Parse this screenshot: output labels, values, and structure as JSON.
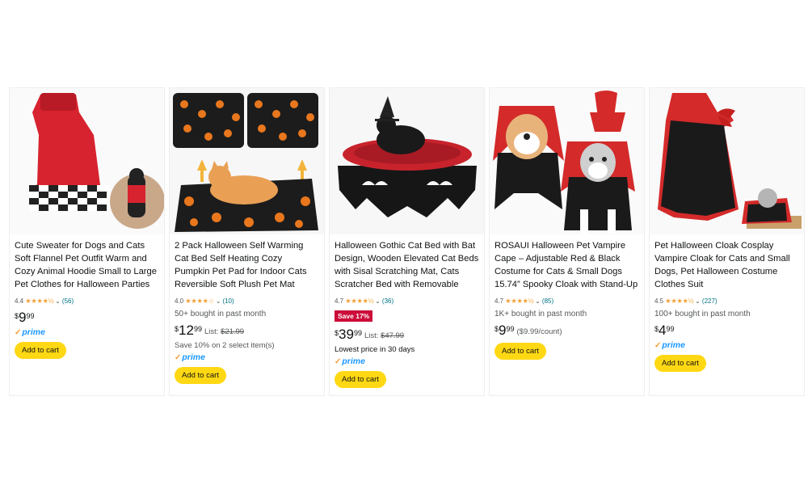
{
  "products": [
    {
      "title": "Cute Sweater for Dogs and Cats Soft Flannel Pet Outfit Warm and Cozy Animal Hoodie Small to Large Pet Clothes for Halloween Parties and…",
      "rating": "4.4",
      "stars": "★★★★½",
      "reviews": "(56)",
      "price_currency": "$",
      "price_whole": "9",
      "price_fraction": "99",
      "prime": "prime",
      "cart": "Add to cart",
      "image_icon": "red-sweater-cat-image"
    },
    {
      "title": "2 Pack Halloween Self Warming Cat Bed Self Heating Cozy Pumpkin Pet Pad for Indoor Cats Reversible Soft Plush Pet Mat Machine Washable f…",
      "rating": "4.0",
      "stars": "★★★★☆",
      "reviews": "(10)",
      "bought": "50+ bought in past month",
      "price_currency": "$",
      "price_whole": "12",
      "price_fraction": "99",
      "list_label": "List:",
      "list_price": "$21.99",
      "save_note": "Save 10% on 2 select item(s)",
      "prime": "prime",
      "cart": "Add to cart",
      "image_icon": "pumpkin-pet-mat-image"
    },
    {
      "title": "Halloween Gothic Cat Bed with Bat Design, Wooden Elevated Cat Beds with Sisal Scratching Mat, Cats Scratcher Bed with Removable Flu…",
      "rating": "4.7",
      "stars": "★★★★½",
      "reviews": "(36)",
      "deal": "Save 17%",
      "price_currency": "$",
      "price_whole": "39",
      "price_fraction": "99",
      "list_label": "List:",
      "list_price": "$47.99",
      "lowest": "Lowest price in 30 days",
      "prime": "prime",
      "cart": "Add to cart",
      "image_icon": "bat-cat-bed-image"
    },
    {
      "title": "ROSAUI Halloween Pet Vampire Cape – Adjustable Red & Black Costume for Cats & Small Dogs 15.74” Spooky Cloak with Stand-Up Collar Funny…",
      "rating": "4.7",
      "stars": "★★★★½",
      "reviews": "(85)",
      "bought": "1K+ bought in past month",
      "price_currency": "$",
      "price_whole": "9",
      "price_fraction": "99",
      "unit_price": "($9.99/count)",
      "cart": "Add to cart",
      "image_icon": "vampire-cape-pets-image"
    },
    {
      "title": "Pet Halloween Cloak Cosplay Vampire Cloak for Cats and Small Dogs, Pet Halloween Costume Clothes Suit",
      "rating": "4.5",
      "stars": "★★★★½",
      "reviews": "(227)",
      "bought": "100+ bought in past month",
      "price_currency": "$",
      "price_whole": "4",
      "price_fraction": "99",
      "prime": "prime",
      "cart": "Add to cart",
      "image_icon": "vampire-cloak-image"
    }
  ],
  "colors": {
    "star": "#f2a33a",
    "link": "#007185",
    "cart_button": "#ffd814",
    "deal_badge": "#cc0c39",
    "prime": "#1a98ff"
  }
}
